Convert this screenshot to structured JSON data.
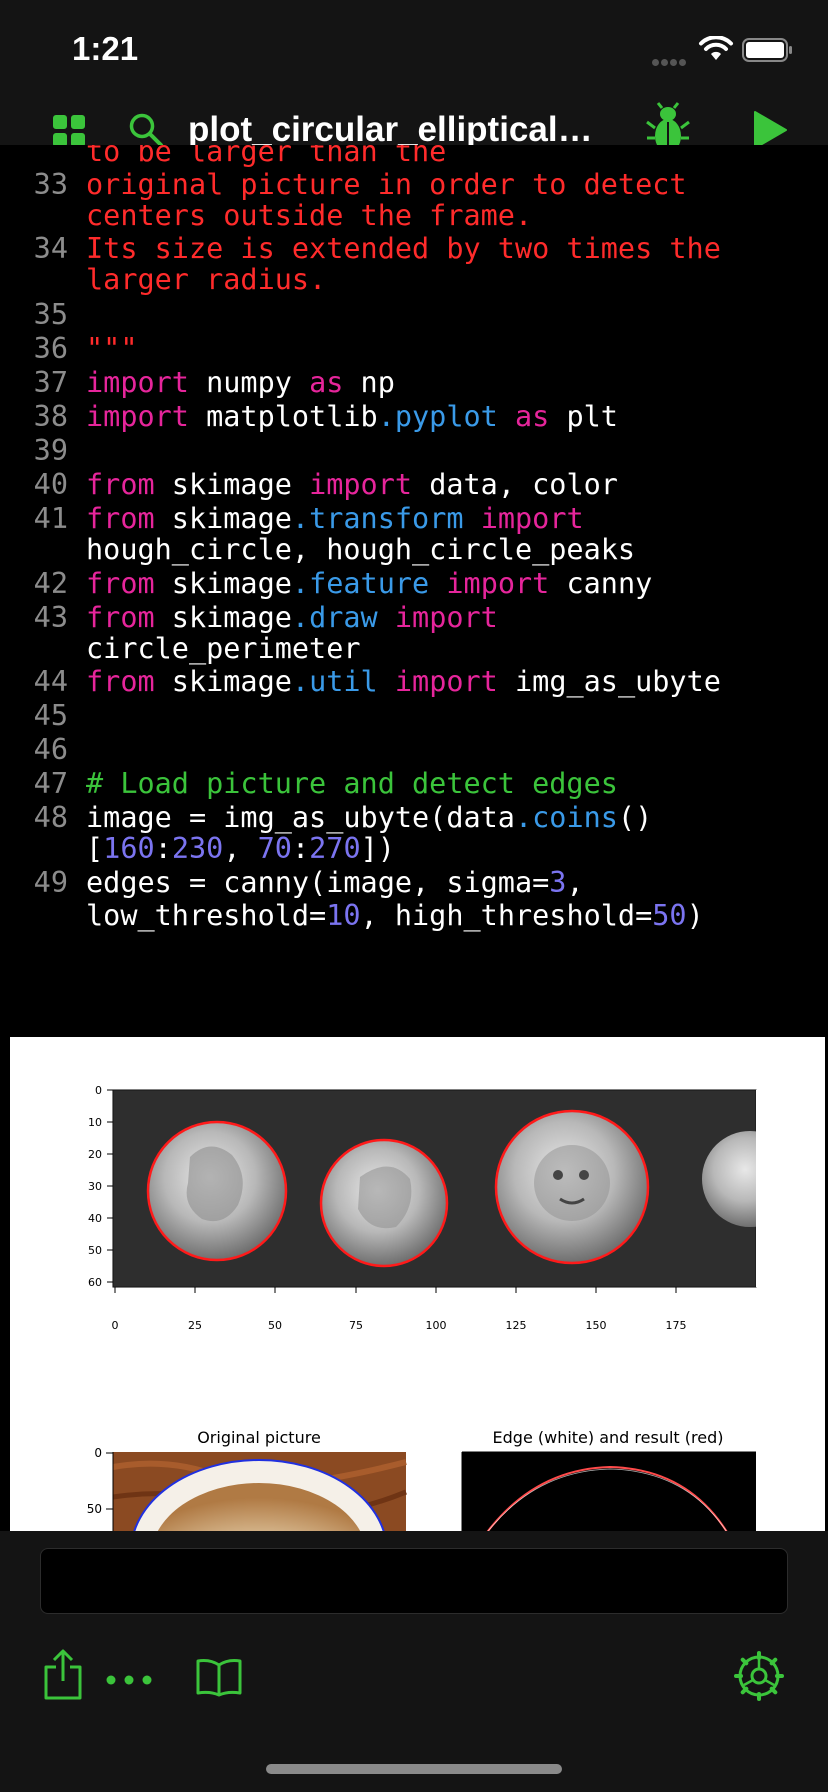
{
  "status_bar": {
    "time": "1:21"
  },
  "nav": {
    "title": "plot_circular_elliptical_h...",
    "icons": [
      "grid-icon",
      "search-icon",
      "bug-icon",
      "play-icon"
    ]
  },
  "code_lines": [
    {
      "num": "",
      "tokens": [
        {
          "t": "to be larger than the",
          "c": "str"
        }
      ]
    },
    {
      "num": "33",
      "tokens": [
        {
          "t": "original picture in order to detect",
          "c": "str"
        }
      ]
    },
    {
      "num": "",
      "tokens": [
        {
          "t": "centers outside the frame.",
          "c": "str"
        }
      ]
    },
    {
      "num": "34",
      "tokens": [
        {
          "t": "Its size is extended by two times the",
          "c": "str"
        }
      ]
    },
    {
      "num": "",
      "tokens": [
        {
          "t": "larger radius.",
          "c": "str"
        }
      ]
    },
    {
      "num": "35",
      "tokens": []
    },
    {
      "num": "36",
      "tokens": [
        {
          "t": "\"\"\"",
          "c": "str"
        }
      ]
    },
    {
      "num": "37",
      "tokens": [
        {
          "t": "import",
          "c": "kw"
        },
        {
          "t": " numpy ",
          "c": "plain"
        },
        {
          "t": "as",
          "c": "kw"
        },
        {
          "t": " np",
          "c": "plain"
        }
      ]
    },
    {
      "num": "38",
      "tokens": [
        {
          "t": "import",
          "c": "kw"
        },
        {
          "t": " matplotlib",
          "c": "plain"
        },
        {
          "t": ".pyplot",
          "c": "mod"
        },
        {
          "t": " ",
          "c": "plain"
        },
        {
          "t": "as",
          "c": "kw"
        },
        {
          "t": " plt",
          "c": "plain"
        }
      ]
    },
    {
      "num": "39",
      "tokens": []
    },
    {
      "num": "40",
      "tokens": [
        {
          "t": "from",
          "c": "kw"
        },
        {
          "t": " skimage ",
          "c": "plain"
        },
        {
          "t": "import",
          "c": "kw"
        },
        {
          "t": " data, color",
          "c": "plain"
        }
      ]
    },
    {
      "num": "41",
      "tokens": [
        {
          "t": "from",
          "c": "kw"
        },
        {
          "t": " skimage",
          "c": "plain"
        },
        {
          "t": ".transform",
          "c": "mod"
        },
        {
          "t": " ",
          "c": "plain"
        },
        {
          "t": "import",
          "c": "kw"
        }
      ]
    },
    {
      "num": "",
      "tokens": [
        {
          "t": "hough_circle, hough_circle_peaks",
          "c": "plain"
        }
      ]
    },
    {
      "num": "42",
      "tokens": [
        {
          "t": "from",
          "c": "kw"
        },
        {
          "t": " skimage",
          "c": "plain"
        },
        {
          "t": ".feature",
          "c": "mod"
        },
        {
          "t": " ",
          "c": "plain"
        },
        {
          "t": "import",
          "c": "kw"
        },
        {
          "t": " canny",
          "c": "plain"
        }
      ]
    },
    {
      "num": "43",
      "tokens": [
        {
          "t": "from",
          "c": "kw"
        },
        {
          "t": " skimage",
          "c": "plain"
        },
        {
          "t": ".draw",
          "c": "mod"
        },
        {
          "t": " ",
          "c": "plain"
        },
        {
          "t": "import",
          "c": "kw"
        }
      ]
    },
    {
      "num": "",
      "tokens": [
        {
          "t": "circle_perimeter",
          "c": "plain"
        }
      ]
    },
    {
      "num": "44",
      "tokens": [
        {
          "t": "from",
          "c": "kw"
        },
        {
          "t": " skimage",
          "c": "plain"
        },
        {
          "t": ".util",
          "c": "mod"
        },
        {
          "t": " ",
          "c": "plain"
        },
        {
          "t": "import",
          "c": "kw"
        },
        {
          "t": " img_as_ubyte",
          "c": "plain"
        }
      ]
    },
    {
      "num": "45",
      "tokens": []
    },
    {
      "num": "46",
      "tokens": []
    },
    {
      "num": "47",
      "tokens": [
        {
          "t": "# Load picture and detect edges",
          "c": "com"
        }
      ]
    },
    {
      "num": "48",
      "tokens": [
        {
          "t": "image = img_as_ubyte(data",
          "c": "plain"
        },
        {
          "t": ".coins",
          "c": "mod"
        },
        {
          "t": "()",
          "c": "plain"
        }
      ]
    },
    {
      "num": "",
      "tokens": [
        {
          "t": "[",
          "c": "plain"
        },
        {
          "t": "160",
          "c": "num"
        },
        {
          "t": ":",
          "c": "plain"
        },
        {
          "t": "230",
          "c": "num"
        },
        {
          "t": ", ",
          "c": "plain"
        },
        {
          "t": "70",
          "c": "num"
        },
        {
          "t": ":",
          "c": "plain"
        },
        {
          "t": "270",
          "c": "num"
        },
        {
          "t": "])",
          "c": "plain"
        }
      ]
    },
    {
      "num": "49",
      "tokens": [
        {
          "t": "edges = canny(image, sigma=",
          "c": "plain"
        },
        {
          "t": "3",
          "c": "num"
        },
        {
          "t": ",",
          "c": "plain"
        }
      ]
    },
    {
      "num": "",
      "tokens": [
        {
          "t": "low_threshold=",
          "c": "plain"
        },
        {
          "t": "10",
          "c": "num"
        },
        {
          "t": ", high_threshold=",
          "c": "plain"
        },
        {
          "t": "50",
          "c": "num"
        },
        {
          "t": ")",
          "c": "plain"
        }
      ]
    }
  ],
  "output": {
    "plot1": {
      "y_ticks": [
        "0",
        "10",
        "20",
        "30",
        "40",
        "50",
        "60"
      ],
      "x_ticks": [
        "0",
        "25",
        "50",
        "75",
        "100",
        "125",
        "150",
        "175"
      ]
    },
    "plot2": {
      "title_left": "Original picture",
      "title_right": "Edge (white) and result (red)",
      "y_ticks": [
        "0",
        "50"
      ]
    }
  },
  "input": {
    "value": "",
    "placeholder": ""
  },
  "toolbar": {
    "icons": [
      "share-icon",
      "more-icon",
      "book-icon",
      "settings-icon"
    ]
  },
  "colors": {
    "accent": "#3bc43b",
    "keyword": "#e6259b",
    "module": "#3a9ae8",
    "number": "#7b74f0",
    "string": "#ff2b2b",
    "comment": "#3bc43b"
  }
}
